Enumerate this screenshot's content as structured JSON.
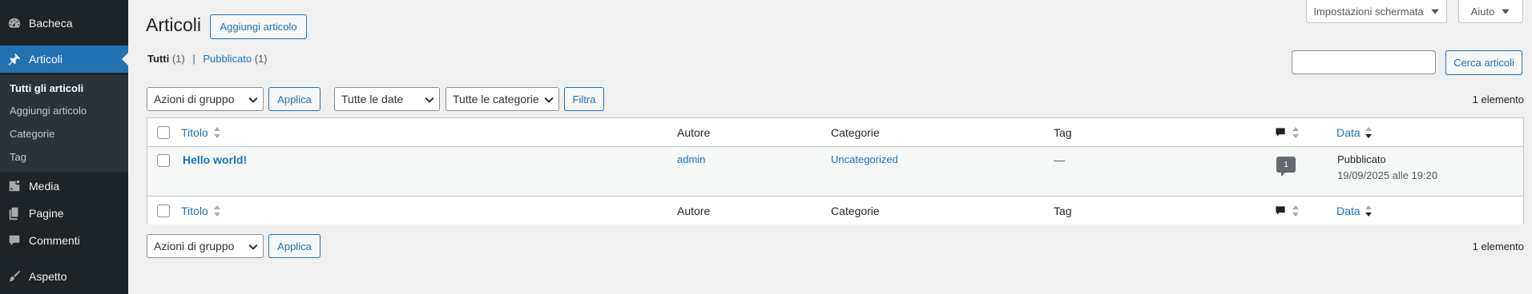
{
  "sidebar": {
    "items": [
      {
        "label": "Bacheca",
        "icon": "dashboard-icon"
      },
      {
        "label": "Articoli",
        "icon": "pin-icon"
      },
      {
        "label": "Media",
        "icon": "media-icon"
      },
      {
        "label": "Pagine",
        "icon": "pages-icon"
      },
      {
        "label": "Commenti",
        "icon": "comments-icon"
      },
      {
        "label": "Aspetto",
        "icon": "brush-icon"
      }
    ],
    "submenu": [
      "Tutti gli articoli",
      "Aggiungi articolo",
      "Categorie",
      "Tag"
    ]
  },
  "header": {
    "title": "Articoli",
    "add_new": "Aggiungi articolo",
    "screen_options": "Impostazioni schermata",
    "help": "Aiuto"
  },
  "views": {
    "all": "Tutti",
    "all_count": "(1)",
    "separator": "|",
    "published": "Pubblicato",
    "published_count": "(1)"
  },
  "search": {
    "button": "Cerca articoli",
    "value": ""
  },
  "filters": {
    "bulk_action": "Azioni di gruppo",
    "apply": "Applica",
    "dates": "Tutte le date",
    "categories": "Tutte le categorie",
    "filter": "Filtra",
    "count": "1 elemento"
  },
  "table": {
    "columns": {
      "title": "Titolo",
      "author": "Autore",
      "categories": "Categorie",
      "tags": "Tag",
      "date": "Data"
    },
    "rows": [
      {
        "title": "Hello world!",
        "author": "admin",
        "category": "Uncategorized",
        "tags": "—",
        "comments": "1",
        "status": "Pubblicato",
        "date": "19/09/2025 alle 19:20"
      }
    ]
  },
  "colors": {
    "accent": "#2271b1",
    "sidebar": "#1d2327",
    "background": "#f0f0f1"
  }
}
